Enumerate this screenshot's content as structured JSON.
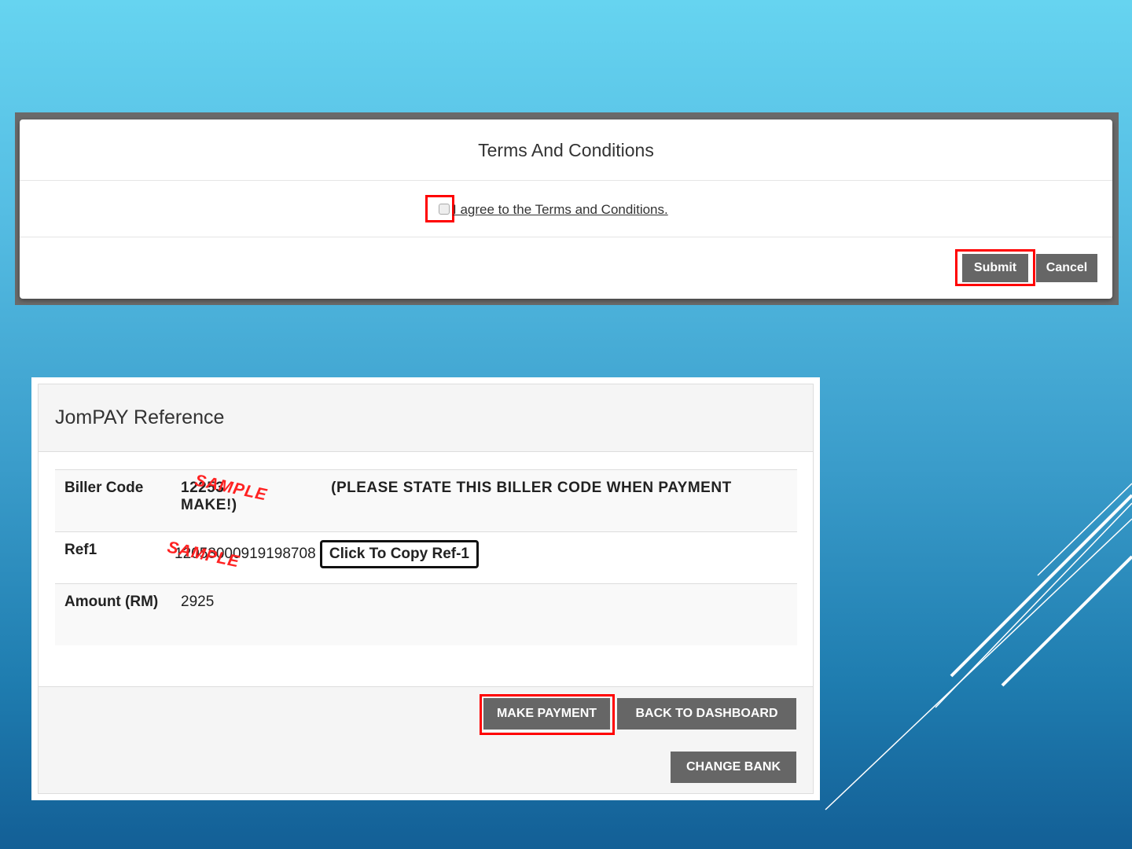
{
  "terms_modal": {
    "title": "Terms And Conditions",
    "agree_label": "I agree to the Terms and Conditions.",
    "agree_checked": false,
    "submit_label": "Submit",
    "cancel_label": "Cancel"
  },
  "jompay": {
    "title": "JomPAY Reference",
    "rows": [
      {
        "label": "Biller Code",
        "value": "12253",
        "note": "(PLEASE STATE THIS BILLER CODE WHEN PAYMENT MAKE!)"
      },
      {
        "label": "Ref1",
        "value": "12053000919198708",
        "button": "Click To Copy Ref-1"
      },
      {
        "label": "Amount (RM)",
        "value": "2925"
      }
    ],
    "watermark": "SAMPLE",
    "make_payment_label": "MAKE PAYMENT",
    "back_label": "BACK TO DASHBOARD",
    "change_bank_label": "CHANGE BANK"
  },
  "colors": {
    "highlight": "#ff0000",
    "button": "#666666"
  }
}
